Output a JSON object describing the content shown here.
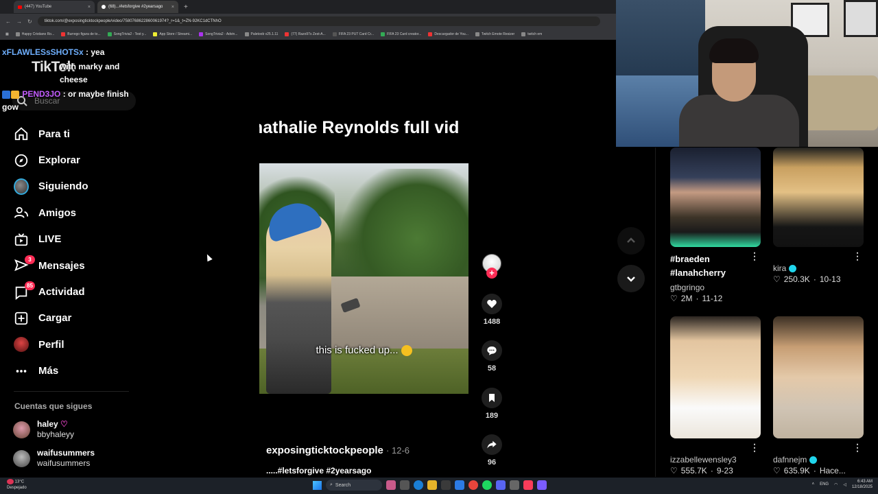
{
  "browser": {
    "tabs": [
      {
        "label": "(447) YouTube"
      },
      {
        "label": "(68)...#letsforgive #2yearsago"
      }
    ],
    "url": "tiktok.com/@exposingticktockpeople/video/7580768622860061974?_r=1&_t=ZN-92KC1dCTNhO",
    "bookmarks": [
      "Happy Cristiano Ro...",
      "Burrego figura de to...",
      "SongTrivia2 - Test y...",
      "App Store / Streami...",
      "SongTrivia2 - Advin...",
      "Paletoob v25.1.11",
      "(77) Razo97s Zest-A...",
      "FIFA 23 PUT Card Cr...",
      "FIFA 23 Card creator...",
      "Descargador de You...",
      "Twitch Emote Resizer",
      "twitch em"
    ]
  },
  "chat": [
    {
      "user": "xFLAWLESsSHOTSx",
      "message": ": yea"
    },
    {
      "user": "",
      "message": "with marky and cheese"
    },
    {
      "user": "PEND3JO",
      "message": ": or maybe finish gow"
    }
  ],
  "tiktok": {
    "logo": "TikTok",
    "search_placeholder": "Buscar",
    "nav": [
      {
        "label": "Para ti",
        "icon": "home-icon"
      },
      {
        "label": "Explorar",
        "icon": "compass-icon"
      },
      {
        "label": "Siguiendo",
        "icon": "following-avatar-icon"
      },
      {
        "label": "Amigos",
        "icon": "friends-icon"
      },
      {
        "label": "LIVE",
        "icon": "live-tv-icon"
      },
      {
        "label": "Mensajes",
        "icon": "messages-icon",
        "badge": "3"
      },
      {
        "label": "Actividad",
        "icon": "activity-icon",
        "badge": "85"
      },
      {
        "label": "Cargar",
        "icon": "upload-icon"
      },
      {
        "label": "Perfil",
        "icon": "profile-avatar-icon"
      },
      {
        "label": "Más",
        "icon": "more-dots-icon"
      }
    ],
    "following_title": "Cuentas que sigues",
    "following": [
      {
        "name": "haley",
        "handle": "bbyhaleyy"
      },
      {
        "name": "waifusummers",
        "handle": "waifusummers"
      }
    ]
  },
  "video": {
    "title": "nathalie Reynolds full vid",
    "subtitle": "this is fucked up...",
    "author": "exposingticktockpeople",
    "date": "12-6",
    "description": ".....#letsforgive #2yearsago",
    "likes": "1488",
    "comments": "58",
    "saves": "189",
    "shares": "96"
  },
  "related": [
    {
      "title": "#braeden #lanahcherry",
      "user": "gtbgringo",
      "verified": false,
      "views": "2M",
      "date": "11-12"
    },
    {
      "title": "",
      "user": "kira",
      "verified": true,
      "views": "250.3K",
      "date": "10-13"
    },
    {
      "title": "",
      "user": "izzabellewensley3",
      "verified": false,
      "views": "555.7K",
      "date": "9-23"
    },
    {
      "title": "",
      "user": "dafnnejm",
      "verified": true,
      "views": "635.9K",
      "date": "Hace..."
    }
  ],
  "taskbar": {
    "weather_temp": "13°C",
    "weather_desc": "Despejado",
    "search_label": "Search",
    "language": "ENG",
    "time": "6:43 AM",
    "date": "12/18/2025"
  },
  "colors": {
    "accent": "#fe2c55",
    "verified": "#20d5ec",
    "background": "#000000"
  }
}
